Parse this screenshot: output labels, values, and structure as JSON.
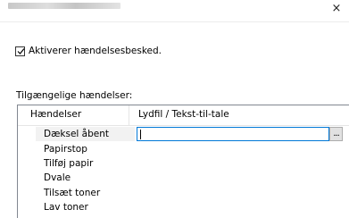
{
  "window": {
    "close_symbol": "×"
  },
  "notification": {
    "checked": true,
    "label": "Aktiverer hændelsesbesked."
  },
  "events_panel": {
    "label": "Tilgængelige hændelser:",
    "columns": [
      "Hændelser",
      "Lydfil / Tekst-til-tale"
    ],
    "selected_index": 0,
    "sound_value": "",
    "browse_label": "...",
    "events": [
      "Dæksel åbent",
      "Papirstop",
      "Tilføj papir",
      "Dvale",
      "Tilsæt toner",
      "Lav toner"
    ]
  },
  "icons": {
    "close": "close-icon",
    "checkbox": "checkmark-icon"
  },
  "colors": {
    "accent": "#0078d7",
    "border": "#828790",
    "selection": "#f2f2f2"
  }
}
